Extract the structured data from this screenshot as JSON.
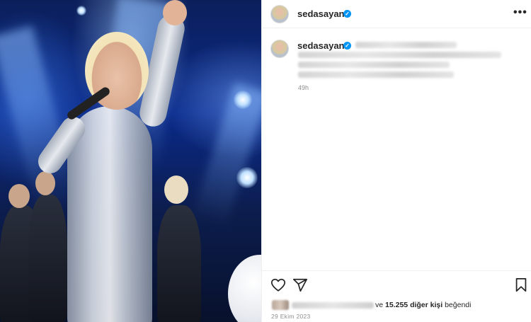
{
  "post": {
    "username": "sedasayan",
    "time_ago": "49h",
    "likes_conjunction": "ve",
    "likes_count": "15.255",
    "likes_suffix": "diğer kişi",
    "likes_verb": "beğendi",
    "date": "29 Ekim 2023"
  },
  "icons": {
    "verified": "verified-badge-icon",
    "more": "more-options-icon",
    "like": "heart-icon",
    "share": "share-icon",
    "save": "bookmark-icon"
  },
  "colors": {
    "verified_blue": "#0095f6",
    "text": "#262626",
    "muted": "#8e8e8e",
    "border": "#efefef"
  }
}
